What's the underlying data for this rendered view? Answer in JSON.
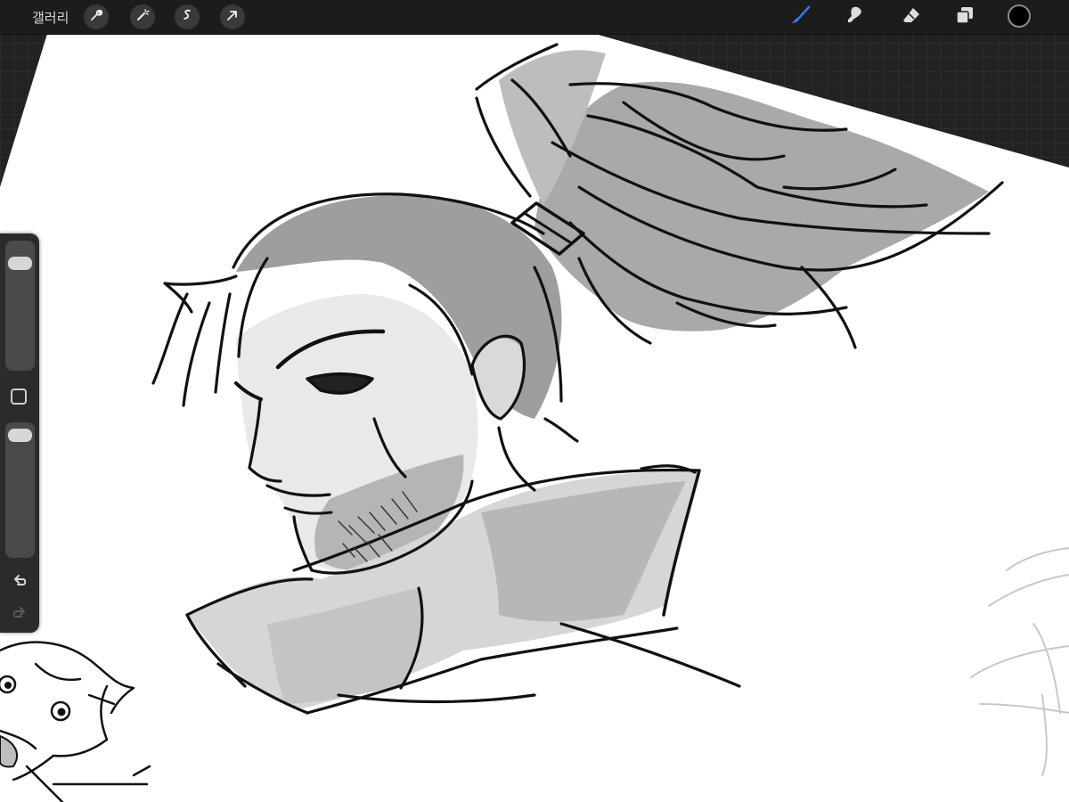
{
  "topbar": {
    "gallery_label": "갤러리",
    "left_actions": [
      {
        "icon": "wrench-icon"
      },
      {
        "icon": "magic-wand-icon"
      },
      {
        "icon": "selection-s-icon"
      },
      {
        "icon": "transform-arrow-icon"
      }
    ],
    "right_tools": [
      {
        "icon": "brush-icon",
        "active": true
      },
      {
        "icon": "smudge-icon",
        "active": false
      },
      {
        "icon": "eraser-icon",
        "active": false
      },
      {
        "icon": "layers-icon",
        "active": false
      }
    ],
    "current_color": "#000000",
    "accent_color": "#2f7df6"
  },
  "sidebar": {
    "brush_size_level": 0.12,
    "opacity_level": 0.03,
    "buttons": [
      "square-modify-icon",
      "undo-icon",
      "redo-icon"
    ]
  }
}
